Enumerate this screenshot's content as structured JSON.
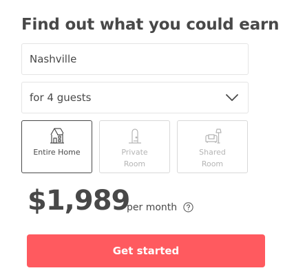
{
  "header": {
    "title": "Find out what you could earn"
  },
  "form": {
    "location": {
      "value": "Nashville"
    },
    "guests": {
      "selected": "for 4 guests",
      "icon": "chevron-down-icon"
    },
    "room_types": [
      {
        "label": "Entire Home",
        "icon": "house-icon",
        "selected": true
      },
      {
        "label_line1": "Private",
        "label_line2": "Room",
        "icon": "lamp-door-icon",
        "selected": false
      },
      {
        "label_line1": "Shared",
        "label_line2": "Room",
        "icon": "sofa-lamp-icon",
        "selected": false
      }
    ]
  },
  "estimate": {
    "amount": "$1,989",
    "period": "per month",
    "help_icon": "question-circle-icon"
  },
  "cta": {
    "label": "Get started",
    "color": "#ff5a5f"
  },
  "colors": {
    "text": "#484848",
    "muted": "#b4b4b4",
    "border": "#e4e4e4",
    "accent": "#ff5a5f"
  }
}
